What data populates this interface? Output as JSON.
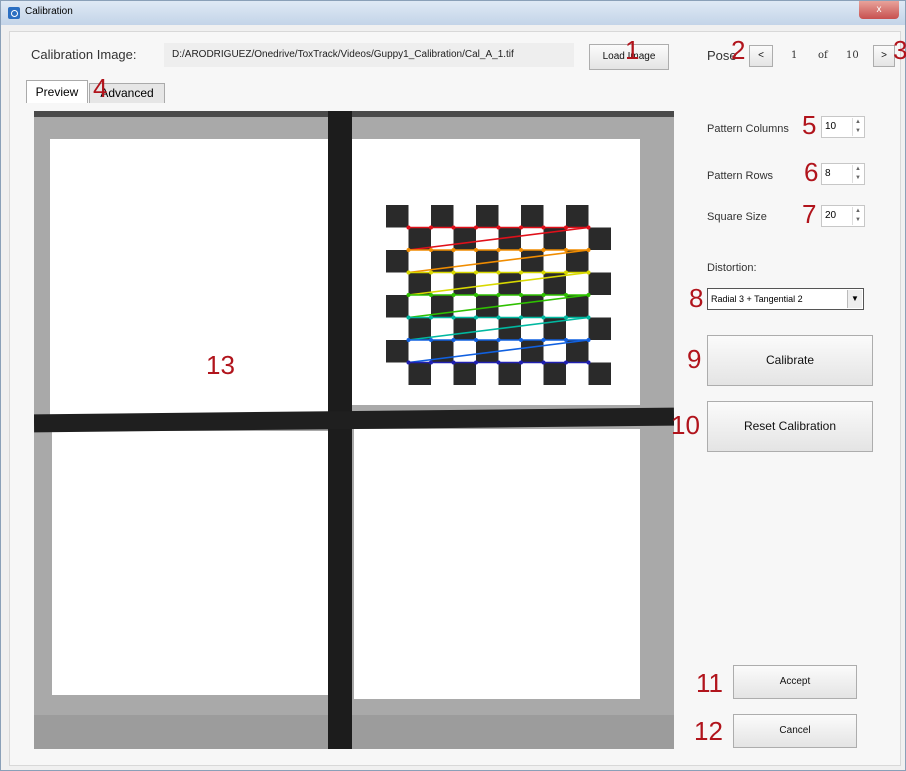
{
  "window": {
    "title": "Calibration",
    "close": "x"
  },
  "header": {
    "image_label": "Calibration Image:",
    "image_path": "D:/ARODRIGUEZ/Onedrive/ToxTrack/Videos/Guppy1_Calibration/Cal_A_1.tif",
    "load_button": "Load Image"
  },
  "pose": {
    "label": "Pose",
    "prev": "<",
    "current": "1",
    "of": "of",
    "total": "10",
    "next": ">"
  },
  "tabs": [
    "Preview",
    "Advanced"
  ],
  "settings": {
    "pattern_columns_label": "Pattern Columns",
    "pattern_columns_value": "10",
    "pattern_rows_label": "Pattern Rows",
    "pattern_rows_value": "8",
    "square_size_label": "Square Size",
    "square_size_value": "20",
    "distortion_label": "Distortion:",
    "distortion_value": "Radial 3 + Tangential 2"
  },
  "buttons": {
    "calibrate": "Calibrate",
    "reset": "Reset Calibration",
    "accept": "Accept",
    "cancel": "Cancel"
  },
  "markers": [
    "1",
    "2",
    "3",
    "4",
    "5",
    "6",
    "7",
    "8",
    "9",
    "10",
    "11",
    "12",
    "13"
  ],
  "colors": {
    "marker": "#b1141c",
    "corner_lines": [
      "#e0101a",
      "#f08c00",
      "#d8d800",
      "#2ec000",
      "#00b8a0",
      "#1060e0",
      "#2020b0"
    ]
  }
}
